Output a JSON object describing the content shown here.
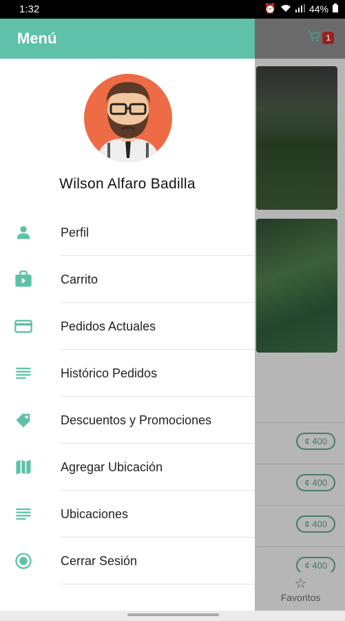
{
  "status_bar": {
    "time": "1:32",
    "battery": "44%"
  },
  "drawer": {
    "title": "Menú",
    "user_name": "Wilson Alfaro Badilla",
    "items": [
      {
        "label": "Perfil",
        "icon": "person-icon"
      },
      {
        "label": "Carrito",
        "icon": "shopping-bag-icon"
      },
      {
        "label": "Pedidos Actuales",
        "icon": "credit-card-icon"
      },
      {
        "label": "Histórico Pedidos",
        "icon": "list-icon"
      },
      {
        "label": "Descuentos y Promociones",
        "icon": "tag-icon"
      },
      {
        "label": "Agregar Ubicación",
        "icon": "map-icon"
      },
      {
        "label": "Ubicaciones",
        "icon": "list-icon"
      },
      {
        "label": "Cerrar Sesión",
        "icon": "radio-button-icon"
      }
    ]
  },
  "background": {
    "cart_count": "1",
    "prices": [
      "¢ 400",
      "¢ 400",
      "¢ 400",
      "¢ 400"
    ],
    "bottom_nav_label": "Favoritos"
  },
  "colors": {
    "accent": "#5ec1a8",
    "badge": "#c62828"
  }
}
